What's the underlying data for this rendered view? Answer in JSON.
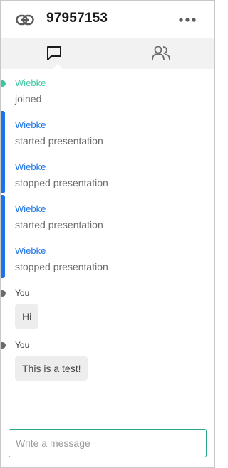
{
  "header": {
    "meeting_id": "97957153",
    "link_icon": "link-icon",
    "more_icon": "more-icon"
  },
  "tabs": [
    {
      "name": "chat",
      "icon": "chat-bubble-icon",
      "active": true
    },
    {
      "name": "participants",
      "icon": "people-icon",
      "active": false
    }
  ],
  "messages": [
    {
      "author": "Wiebke",
      "text": "joined",
      "kind": "join"
    },
    {
      "author": "Wiebke",
      "text": "started presentation",
      "kind": "status"
    },
    {
      "author": "Wiebke",
      "text": "stopped presentation",
      "kind": "status"
    },
    {
      "author": "Wiebke",
      "text": "started presentation",
      "kind": "status"
    },
    {
      "author": "Wiebke",
      "text": "stopped presentation",
      "kind": "status"
    },
    {
      "author": "You",
      "text": "Hi",
      "kind": "chat"
    },
    {
      "author": "You",
      "text": "This is a test!",
      "kind": "chat"
    }
  ],
  "composer": {
    "placeholder": "Write a message",
    "value": ""
  },
  "colors": {
    "accent_blue": "#1a73e8",
    "join_green": "#3ec6a2",
    "composer_border": "#27a58a"
  }
}
